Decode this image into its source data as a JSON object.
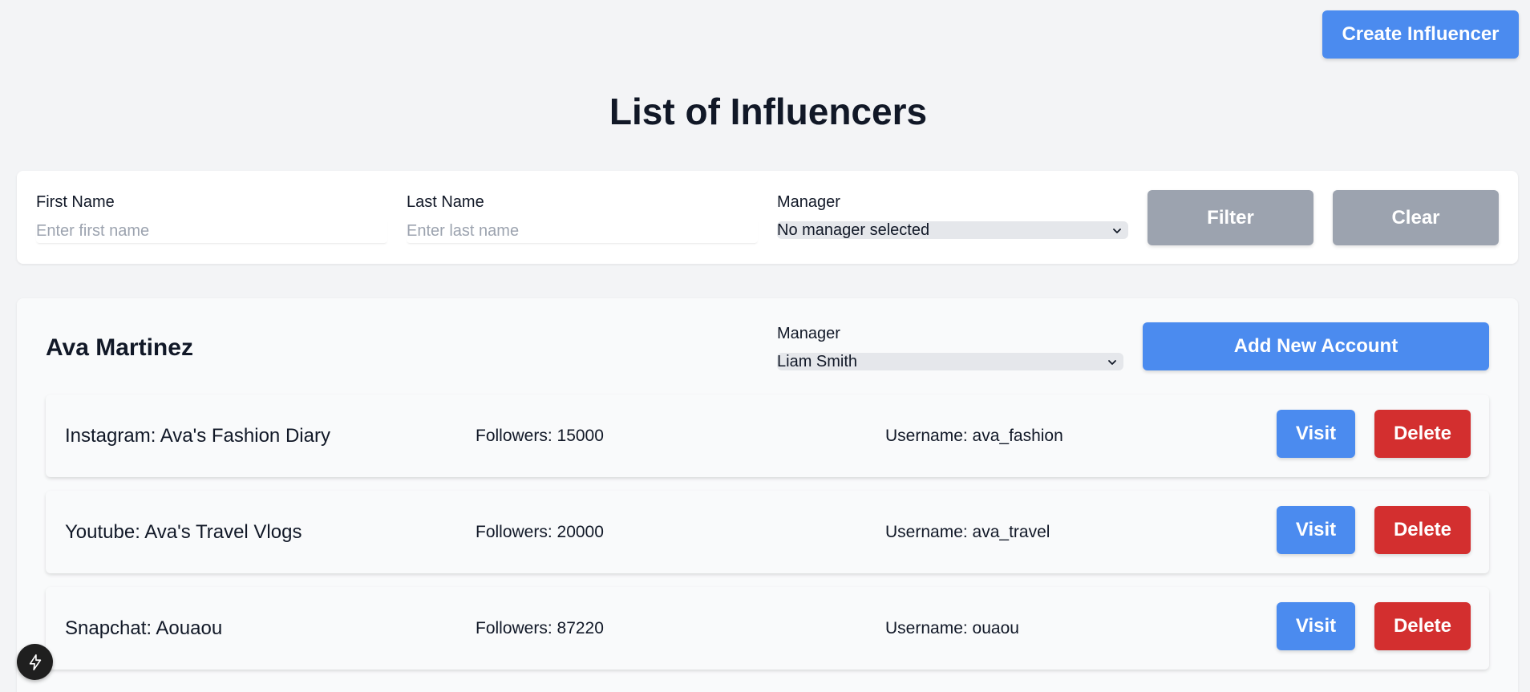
{
  "header": {
    "create_label": "Create Influencer",
    "title": "List of Influencers"
  },
  "filter": {
    "first_name_label": "First Name",
    "first_name_placeholder": "Enter first name",
    "last_name_label": "Last Name",
    "last_name_placeholder": "Enter last name",
    "manager_label": "Manager",
    "manager_value": "No manager selected",
    "filter_label": "Filter",
    "clear_label": "Clear"
  },
  "influencer": {
    "name": "Ava Martinez",
    "manager_label": "Manager",
    "manager_value": "Liam Smith",
    "add_account_label": "Add New Account",
    "accounts": [
      {
        "name": "Instagram: Ava's Fashion Diary",
        "followers": "Followers: 15000",
        "username": "Username: ava_fashion",
        "visit_label": "Visit",
        "delete_label": "Delete"
      },
      {
        "name": "Youtube: Ava's Travel Vlogs",
        "followers": "Followers: 20000",
        "username": "Username: ava_travel",
        "visit_label": "Visit",
        "delete_label": "Delete"
      },
      {
        "name": "Snapchat: Aouaou",
        "followers": "Followers: 87220",
        "username": "Username: ouaou",
        "visit_label": "Visit",
        "delete_label": "Delete"
      }
    ]
  },
  "icons": {
    "dropdown": "chevron-down-icon",
    "dev_tools": "lightning-bolt-icon"
  },
  "colors": {
    "primary": "#4b8bef",
    "danger": "#d32f2f",
    "disabled": "#9ca3af"
  }
}
